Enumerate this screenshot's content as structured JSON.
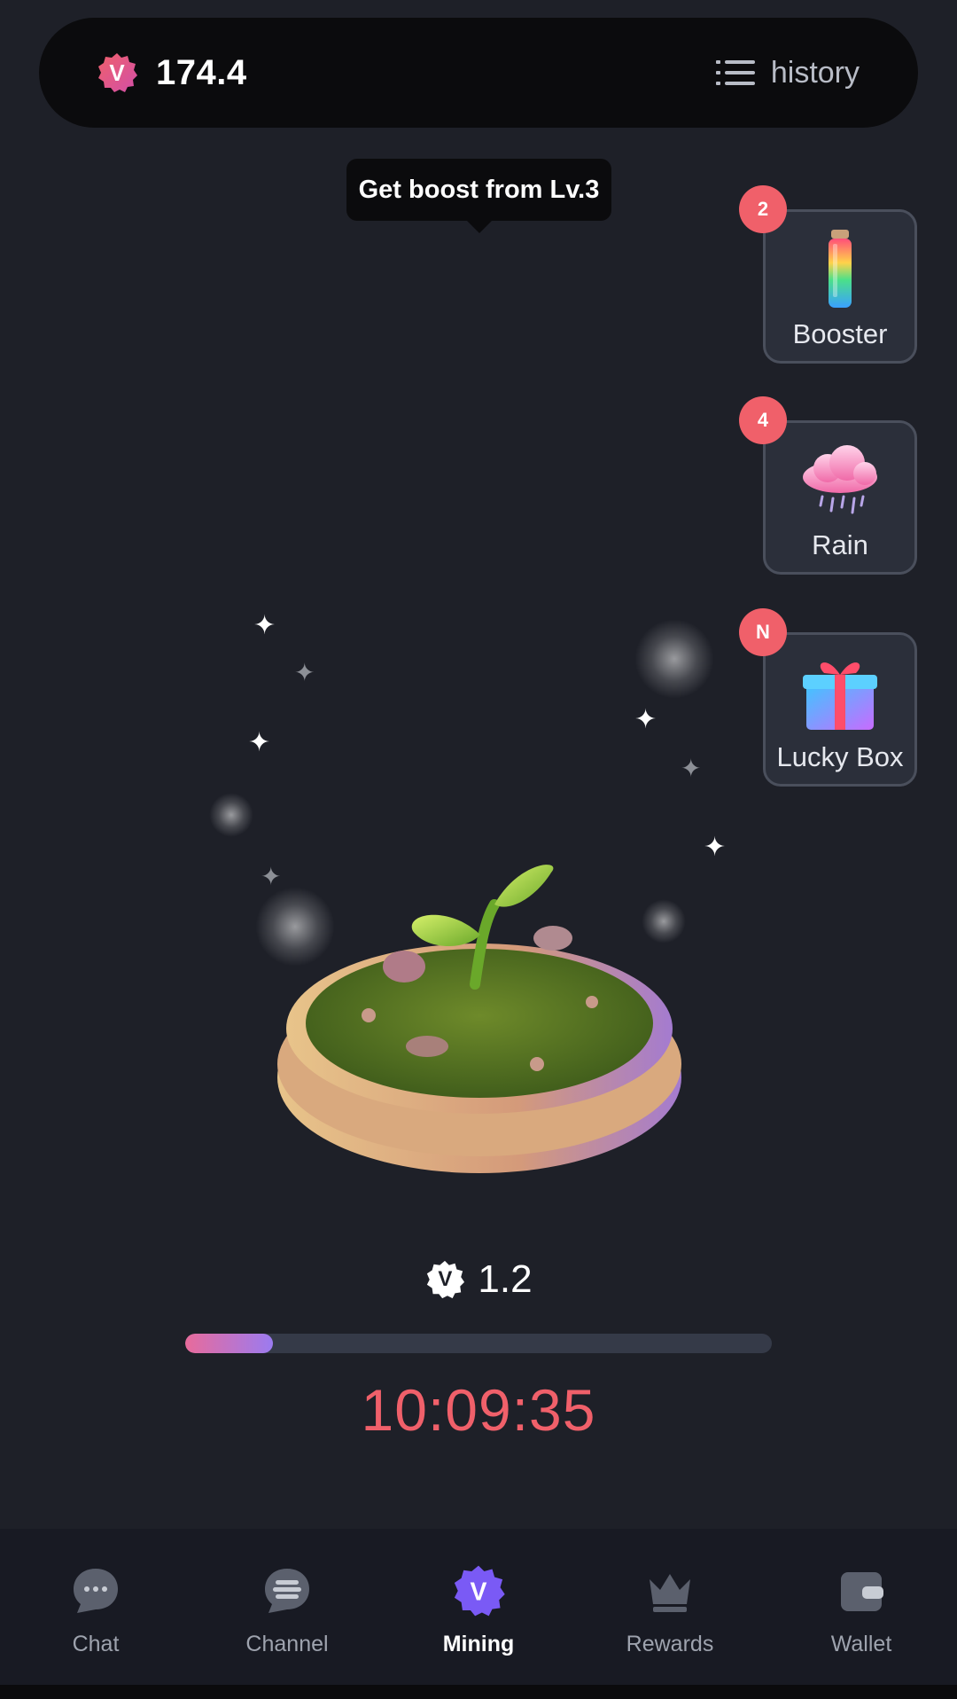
{
  "header": {
    "currency_icon": "v-coin-icon",
    "currency_letter": "V",
    "balance": "174.4",
    "history_label": "history"
  },
  "tooltip": {
    "text": "Get boost from Lv.3"
  },
  "side_actions": [
    {
      "label": "Booster",
      "badge": "2",
      "icon": "potion-bottle-icon"
    },
    {
      "label": "Rain",
      "badge": "4",
      "icon": "rain-cloud-icon"
    },
    {
      "label": "Lucky Box",
      "badge": "N",
      "icon": "gift-box-icon"
    }
  ],
  "reward": {
    "letter": "V",
    "value": "1.2"
  },
  "progress": {
    "fraction": 0.15
  },
  "timer": "10:09:35",
  "nav": [
    {
      "label": "Chat",
      "icon": "chat-bubble-icon",
      "active": false
    },
    {
      "label": "Channel",
      "icon": "channel-icon",
      "active": false
    },
    {
      "label": "Mining",
      "icon": "v-coin-icon",
      "active": true
    },
    {
      "label": "Rewards",
      "icon": "crown-icon",
      "active": false
    },
    {
      "label": "Wallet",
      "icon": "wallet-icon",
      "active": false
    }
  ],
  "colors": {
    "accent_red": "#f0606a",
    "accent_purple": "#7a5af5",
    "background": "#1e2028"
  }
}
